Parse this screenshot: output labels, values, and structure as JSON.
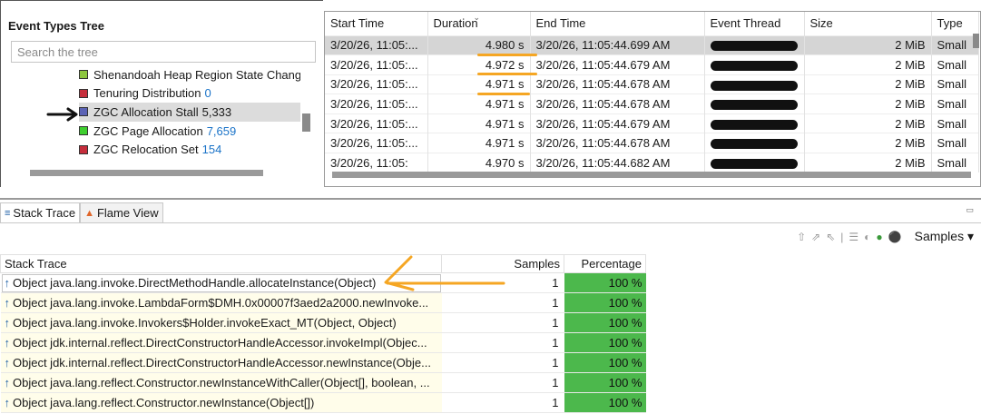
{
  "event_tree": {
    "title": "Event Types Tree",
    "search_placeholder": "Search the tree",
    "items": [
      {
        "label": "Shenandoah Heap Region State Chang",
        "count": "",
        "color": "#8dc63f"
      },
      {
        "label": "Tenuring Distribution",
        "count": "0",
        "color": "#c62e3c"
      },
      {
        "label": "ZGC Allocation Stall",
        "count": "5,333",
        "color": "#5b63b5",
        "selected": true
      },
      {
        "label": "ZGC Page Allocation",
        "count": "7,659",
        "color": "#3fcf2f"
      },
      {
        "label": "ZGC Relocation Set",
        "count": "154",
        "color": "#c62e3c"
      }
    ]
  },
  "events_table": {
    "columns": [
      "Start Time",
      "Duration",
      "End Time",
      "Event Thread",
      "Size",
      "Type"
    ],
    "rows": [
      {
        "start": "3/20/26, 11:05:...",
        "duration": "4.980 s",
        "end": "3/20/26, 11:05:44.699 AM",
        "size": "2 MiB",
        "type": "Small"
      },
      {
        "start": "3/20/26, 11:05:...",
        "duration": "4.972 s",
        "end": "3/20/26, 11:05:44.679 AM",
        "size": "2 MiB",
        "type": "Small"
      },
      {
        "start": "3/20/26, 11:05:...",
        "duration": "4.971 s",
        "end": "3/20/26, 11:05:44.678 AM",
        "size": "2 MiB",
        "type": "Small"
      },
      {
        "start": "3/20/26, 11:05:...",
        "duration": "4.971 s",
        "end": "3/20/26, 11:05:44.678 AM",
        "size": "2 MiB",
        "type": "Small"
      },
      {
        "start": "3/20/26, 11:05:...",
        "duration": "4.971 s",
        "end": "3/20/26, 11:05:44.679 AM",
        "size": "2 MiB",
        "type": "Small"
      },
      {
        "start": "3/20/26, 11:05:...",
        "duration": "4.971 s",
        "end": "3/20/26, 11:05:44.678 AM",
        "size": "2 MiB",
        "type": "Small"
      },
      {
        "start": "3/20/26, 11:05:",
        "duration": "4.970 s",
        "end": "3/20/26, 11:05:44.682 AM",
        "size": "2 MiB",
        "type": "Small"
      }
    ]
  },
  "tabs": {
    "stack_trace": "Stack Trace",
    "flame_view": "Flame View"
  },
  "toolbar": {
    "samples_label": "Samples"
  },
  "stack_trace": {
    "columns": {
      "frame": "Stack Trace",
      "samples": "Samples",
      "percentage": "Percentage"
    },
    "rows": [
      {
        "frame": "Object java.lang.invoke.DirectMethodHandle.allocateInstance(Object)",
        "samples": "1",
        "percentage": "100 %"
      },
      {
        "frame": "Object java.lang.invoke.LambdaForm$DMH.0x00007f3aed2a2000.newInvoke...",
        "samples": "1",
        "percentage": "100 %"
      },
      {
        "frame": "Object java.lang.invoke.Invokers$Holder.invokeExact_MT(Object, Object)",
        "samples": "1",
        "percentage": "100 %"
      },
      {
        "frame": "Object jdk.internal.reflect.DirectConstructorHandleAccessor.invokeImpl(Objec...",
        "samples": "1",
        "percentage": "100 %"
      },
      {
        "frame": "Object jdk.internal.reflect.DirectConstructorHandleAccessor.newInstance(Obje...",
        "samples": "1",
        "percentage": "100 %"
      },
      {
        "frame": "Object java.lang.reflect.Constructor.newInstanceWithCaller(Object[], boolean, ...",
        "samples": "1",
        "percentage": "100 %"
      },
      {
        "frame": "Object java.lang.reflect.Constructor.newInstance(Object[])",
        "samples": "1",
        "percentage": "100 %"
      }
    ]
  },
  "colors": {
    "annotation_orange": "#f5a623",
    "percentage_green": "#4cb84c",
    "selection_gray": "#d5d5d5"
  }
}
